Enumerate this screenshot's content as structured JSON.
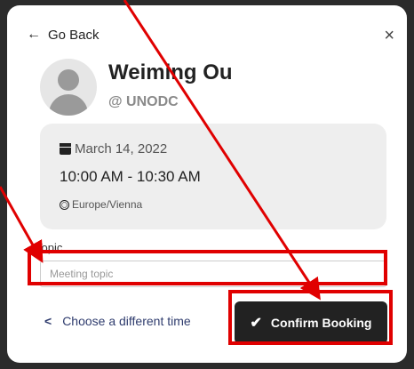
{
  "nav": {
    "back_label": "Go Back",
    "back_icon": "←",
    "close_icon": "×"
  },
  "profile": {
    "name": "Weiming Ou",
    "org": "@ UNODC"
  },
  "booking": {
    "date": "March 14, 2022",
    "time": "10:00 AM - 10:30 AM",
    "timezone": "Europe/Vienna"
  },
  "form": {
    "topic_label": "Topic",
    "topic_placeholder": "Meeting topic",
    "topic_value": ""
  },
  "actions": {
    "choose_time_label": "Choose a different time",
    "chevron": "<",
    "confirm_label": "Confirm Booking",
    "check": "✔"
  },
  "colors": {
    "annotation": "#e00000",
    "confirm_bg": "#222222",
    "link": "#2f3c6e"
  }
}
